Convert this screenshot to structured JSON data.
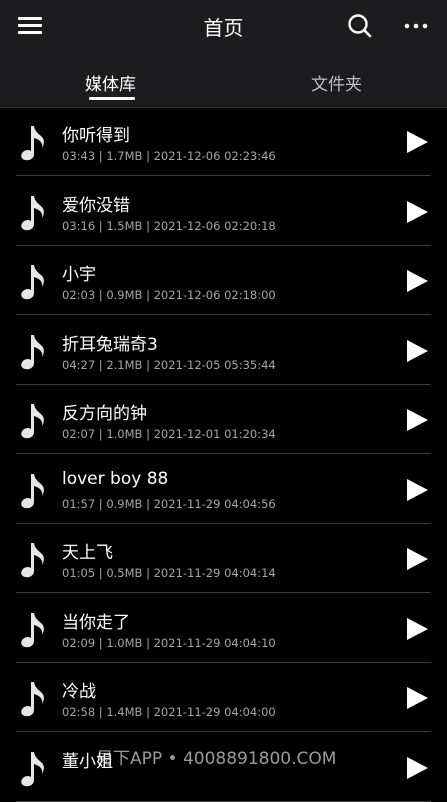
{
  "header": {
    "title": "首页"
  },
  "tabs": [
    {
      "label": "媒体库"
    },
    {
      "label": "文件夹"
    }
  ],
  "songs": [
    {
      "title": "你听得到",
      "meta": "03:43 | 1.7MB | 2021-12-06 02:23:46"
    },
    {
      "title": "爱你没错",
      "meta": "03:16 | 1.5MB | 2021-12-06 02:20:18"
    },
    {
      "title": "小宇",
      "meta": "02:03 | 0.9MB | 2021-12-06 02:18:00"
    },
    {
      "title": "折耳兔瑞奇3",
      "meta": "04:27 | 2.1MB | 2021-12-05 05:35:44"
    },
    {
      "title": "反方向的钟",
      "meta": "02:07 | 1.0MB | 2021-12-01 01:20:34"
    },
    {
      "title": "lover boy 88",
      "meta": "01:57 | 0.9MB | 2021-11-29 04:04:56"
    },
    {
      "title": "天上飞",
      "meta": "01:05 | 0.5MB | 2021-11-29 04:04:14"
    },
    {
      "title": "当你走了",
      "meta": "02:09 | 1.0MB | 2021-11-29 04:04:10"
    },
    {
      "title": "冷战",
      "meta": "02:58 | 1.4MB | 2021-11-29 04:04:00"
    },
    {
      "title": "董小姐",
      "meta": ""
    }
  ],
  "watermark": "易下APP • 4008891800.COM",
  "icons": {
    "menu": "menu-icon",
    "search": "search-icon",
    "more": "more-icon",
    "song": "music-note-icon",
    "play": "play-icon"
  },
  "colors": {
    "background": "#000000",
    "bar": "#1c1c1e",
    "text": "#ffffff",
    "meta": "#a6a6a6",
    "divider": "#3a3a3a"
  }
}
